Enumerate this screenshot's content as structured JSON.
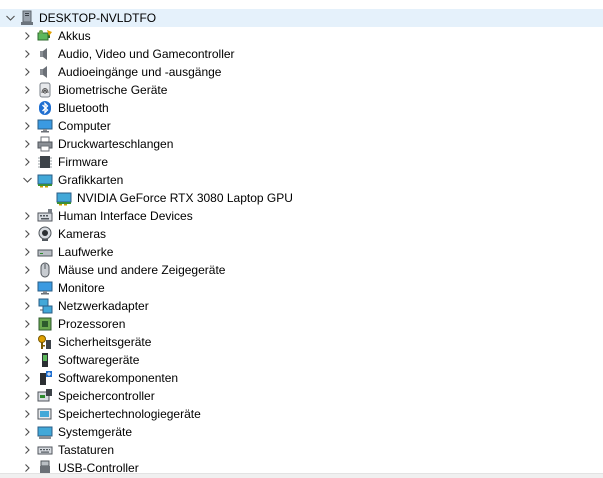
{
  "root": {
    "label": "DESKTOP-NVLDTFO",
    "icon": "computer-tower-icon",
    "expanded": true
  },
  "categories": [
    {
      "label": "Akkus",
      "icon": "battery-icon"
    },
    {
      "label": "Audio, Video und Gamecontroller",
      "icon": "speaker-icon"
    },
    {
      "label": "Audioeingänge und -ausgänge",
      "icon": "speaker-icon"
    },
    {
      "label": "Biometrische Geräte",
      "icon": "fingerprint-icon"
    },
    {
      "label": "Bluetooth",
      "icon": "bluetooth-icon"
    },
    {
      "label": "Computer",
      "icon": "monitor-icon"
    },
    {
      "label": "Druckwarteschlangen",
      "icon": "printer-icon"
    },
    {
      "label": "Firmware",
      "icon": "chip-icon"
    },
    {
      "label": "Grafikkarten",
      "icon": "display-adapter-icon",
      "expanded": true,
      "children": [
        {
          "label": "NVIDIA GeForce RTX 3080 Laptop GPU",
          "icon": "display-adapter-icon"
        }
      ]
    },
    {
      "label": "Human Interface Devices",
      "icon": "keyboard-hid-icon"
    },
    {
      "label": "Kameras",
      "icon": "webcam-icon"
    },
    {
      "label": "Laufwerke",
      "icon": "drive-icon"
    },
    {
      "label": "Mäuse und andere Zeigegeräte",
      "icon": "mouse-icon"
    },
    {
      "label": "Monitore",
      "icon": "monitor-icon"
    },
    {
      "label": "Netzwerkadapter",
      "icon": "network-icon"
    },
    {
      "label": "Prozessoren",
      "icon": "processor-icon"
    },
    {
      "label": "Sicherheitsgeräte",
      "icon": "security-key-icon"
    },
    {
      "label": "Softwaregeräte",
      "icon": "software-device-icon"
    },
    {
      "label": "Softwarekomponenten",
      "icon": "software-component-icon"
    },
    {
      "label": "Speichercontroller",
      "icon": "storage-controller-icon"
    },
    {
      "label": "Speichertechnologiegeräte",
      "icon": "storage-tech-icon"
    },
    {
      "label": "Systemgeräte",
      "icon": "system-device-icon"
    },
    {
      "label": "Tastaturen",
      "icon": "keyboard-icon"
    },
    {
      "label": "USB-Controller",
      "icon": "usb-icon"
    }
  ]
}
